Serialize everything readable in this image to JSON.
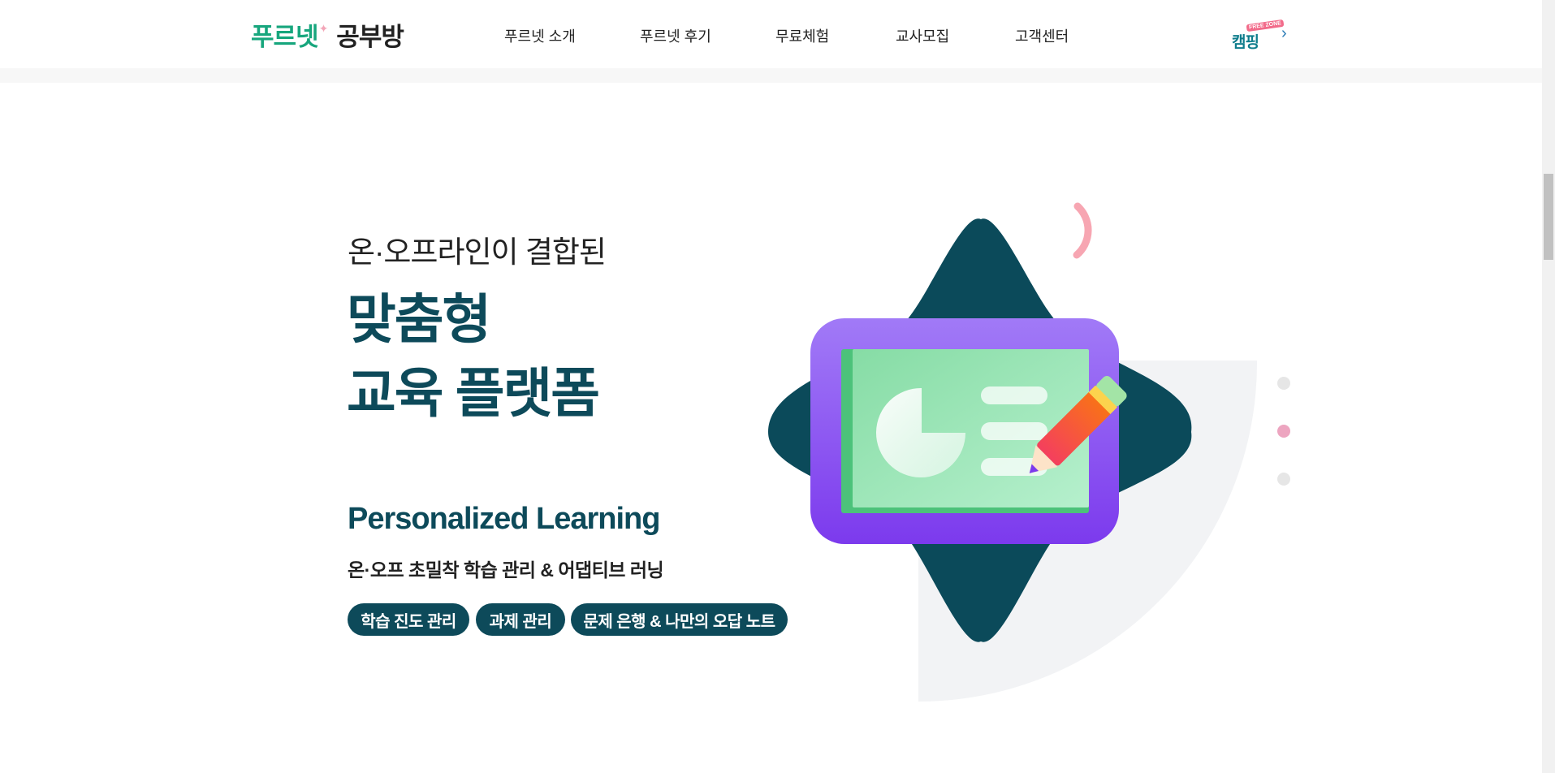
{
  "header": {
    "logo_brand": "푸르넷",
    "logo_spark": "✦",
    "logo_sub": "공부방",
    "nav": [
      {
        "label": "푸르넷 소개"
      },
      {
        "label": "푸르넷 후기"
      },
      {
        "label": "무료체험"
      },
      {
        "label": "교사모집"
      },
      {
        "label": "고객센터"
      }
    ],
    "camp_badge_tag": "FREE ZONE",
    "camp_badge_word": "캠핑",
    "camp_arrow": "›"
  },
  "hero": {
    "eyebrow": "온·오프라인이 결합된",
    "title_line1": "맞춤형",
    "title_line2": "교육 플랫폼",
    "en_title": "Personalized Learning",
    "sub_title": "온·오프 초밀착 학습 관리 & 어댑티브 러닝",
    "tags": [
      {
        "label": "학습 진도 관리"
      },
      {
        "label": "과제 관리"
      },
      {
        "label": "문제 은행 & 나만의 오답 노트"
      }
    ]
  },
  "slider": {
    "active_index": 1,
    "count": 3
  },
  "colors": {
    "brand_green": "#17a67d",
    "navy": "#0d4a5a",
    "purple": "#8b5cf6",
    "pink_dot": "#eda5c0"
  }
}
